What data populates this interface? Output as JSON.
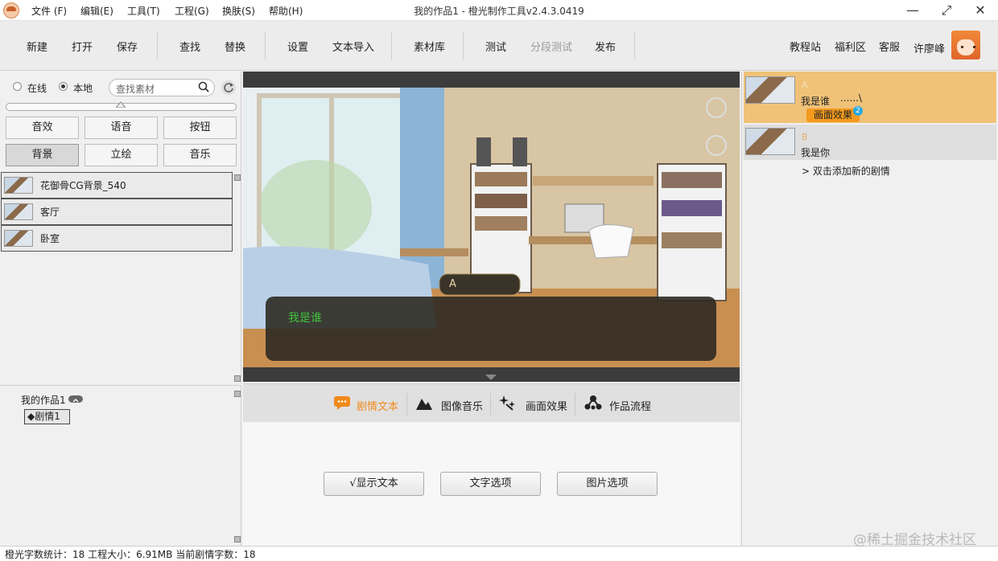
{
  "menu": [
    "文件 (F)",
    "编辑(E)",
    "工具(T)",
    "工程(G)",
    "换肤(S)",
    "帮助(H)"
  ],
  "window": {
    "title": "我的作品1 - 橙光制作工具v2.4.3.0419",
    "min": "—",
    "max": "⤢",
    "close": "✕"
  },
  "toolbar": {
    "items": [
      "新建",
      "打开",
      "保存",
      "查找",
      "替换",
      "设置",
      "文本导入",
      "素材库",
      "测试",
      "分段测试",
      "发布"
    ],
    "right": [
      "教程站",
      "福利区",
      "客服",
      "许廖峰"
    ]
  },
  "resource": {
    "radio_online": "在线",
    "radio_local": "本地",
    "selected_radio": "本地",
    "search_placeholder": "查找素材",
    "categories": [
      "音效",
      "语音",
      "按钮",
      "背景",
      "立绘",
      "音乐"
    ],
    "active_category": "背景",
    "items": [
      "花御骨CG背景_540",
      "客厅",
      "卧室"
    ]
  },
  "tree": {
    "project": "我的作品1",
    "node": "◆剧情1"
  },
  "preview": {
    "name_label": "A",
    "dialog_text": "我是谁"
  },
  "tabs": {
    "items": [
      "剧情文本",
      "图像音乐",
      "画面效果",
      "作品流程"
    ],
    "active": "剧情文本"
  },
  "options": [
    "√显示文本",
    "文字选项",
    "图片选项"
  ],
  "story": {
    "entries": [
      {
        "speaker": "A",
        "text": "我是谁",
        "extra": "......\\",
        "tag": "画面效果",
        "badge": "2"
      },
      {
        "speaker": "B",
        "text": "我是你"
      }
    ],
    "add_hint": "> 双击添加新的剧情"
  },
  "status": "橙光字数统计：18  工程大小：6.91MB  当前剧情字数：18",
  "watermark": "@稀土掘金技术社区",
  "colors": {
    "accent": "#f08a1a",
    "selected_story": "#f0c277",
    "tag": "#f39a1e",
    "badge": "#2aa9e0",
    "dialog_text": "#3ec23e"
  }
}
